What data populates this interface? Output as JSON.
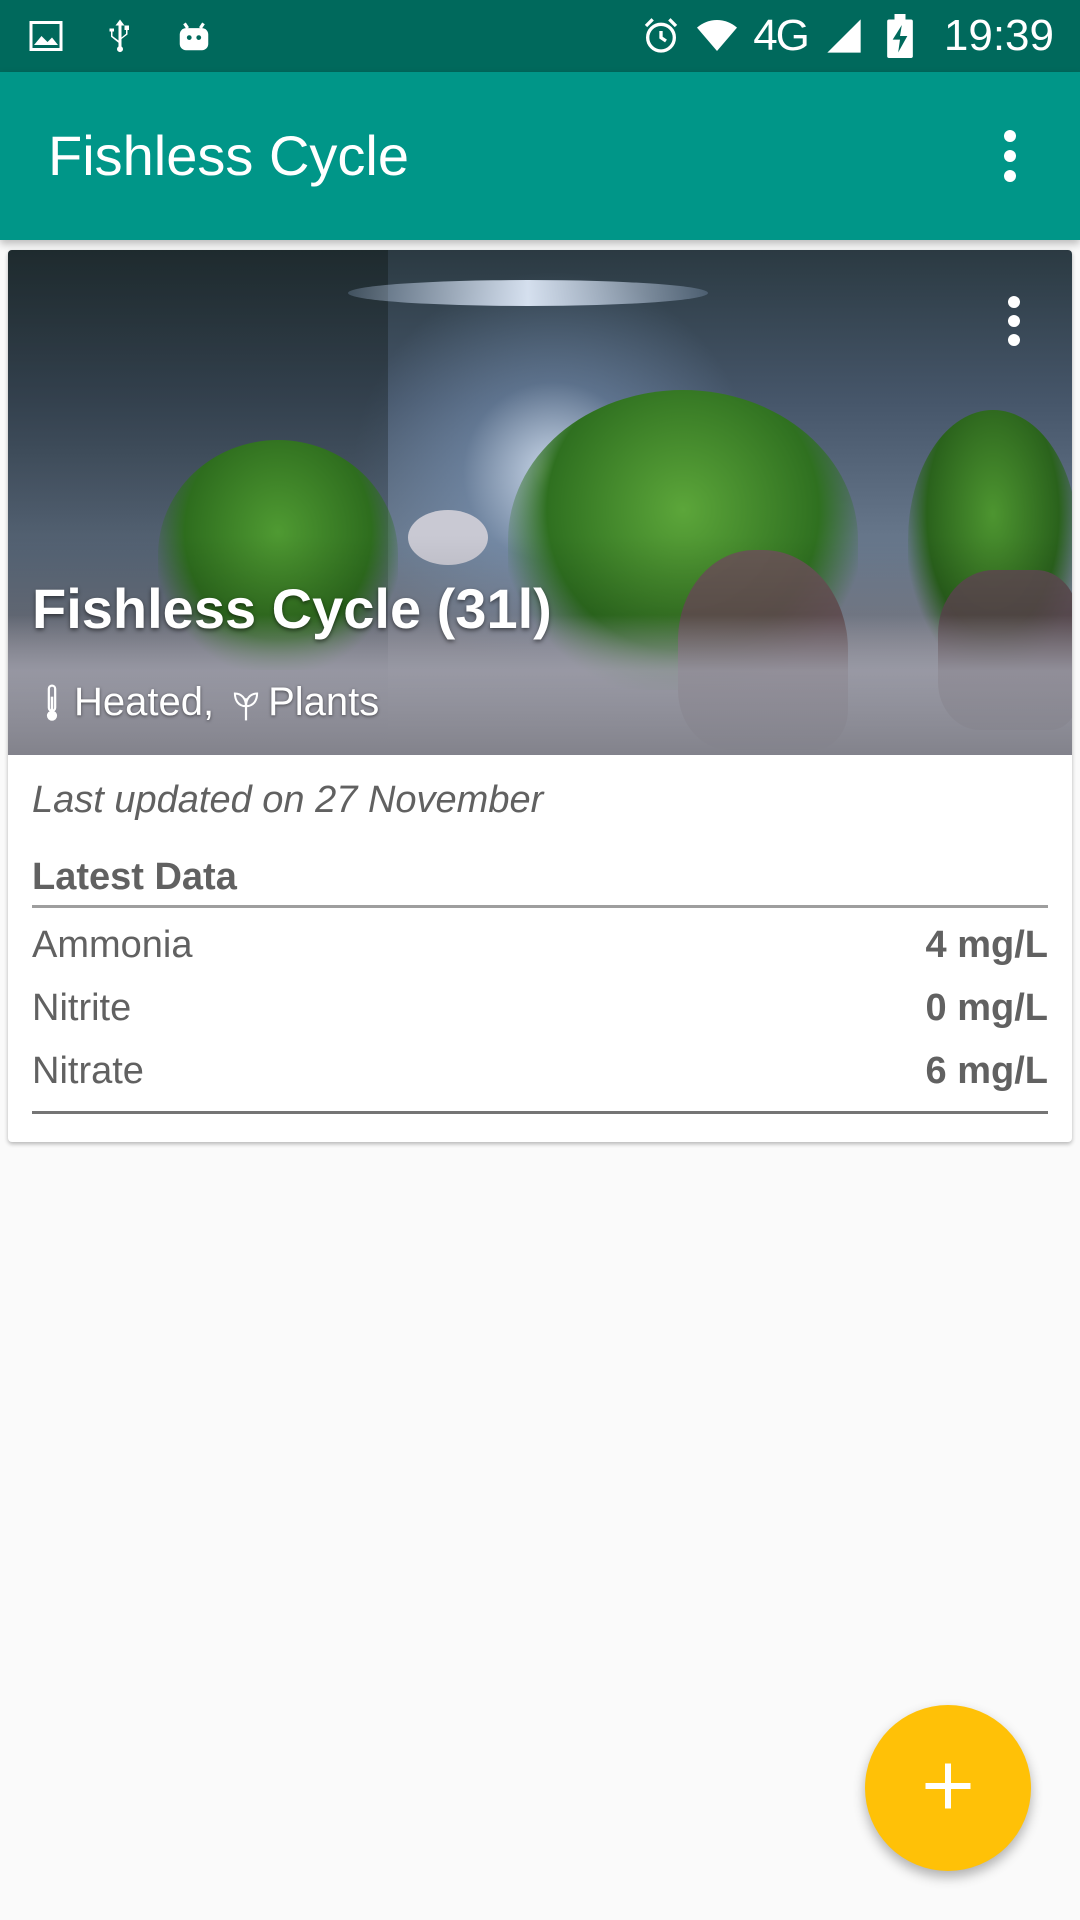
{
  "status_bar": {
    "network": "4G",
    "time": "19:39",
    "icons": [
      "gallery-icon",
      "usb-icon",
      "android-debug-icon",
      "alarm-icon",
      "wifi-icon",
      "signal-icon",
      "battery-charging-icon"
    ]
  },
  "app_bar": {
    "title": "Fishless Cycle",
    "menu_icon": "more-vert-icon"
  },
  "tank_card": {
    "title": "Fishless Cycle (31l)",
    "tags": [
      {
        "icon": "thermometer-icon",
        "label": "Heated,"
      },
      {
        "icon": "plant-icon",
        "label": "Plants"
      }
    ],
    "last_updated": "Last updated on 27 November",
    "section_title": "Latest Data",
    "readings": [
      {
        "label": "Ammonia",
        "value": "4 mg/L"
      },
      {
        "label": "Nitrite",
        "value": "0 mg/L"
      },
      {
        "label": "Nitrate",
        "value": "6 mg/L"
      }
    ]
  },
  "fab": {
    "icon": "add-icon"
  },
  "colors": {
    "status_bar": "#00695c",
    "app_bar": "#009688",
    "fab": "#ffc107",
    "background": "#fafafa"
  }
}
